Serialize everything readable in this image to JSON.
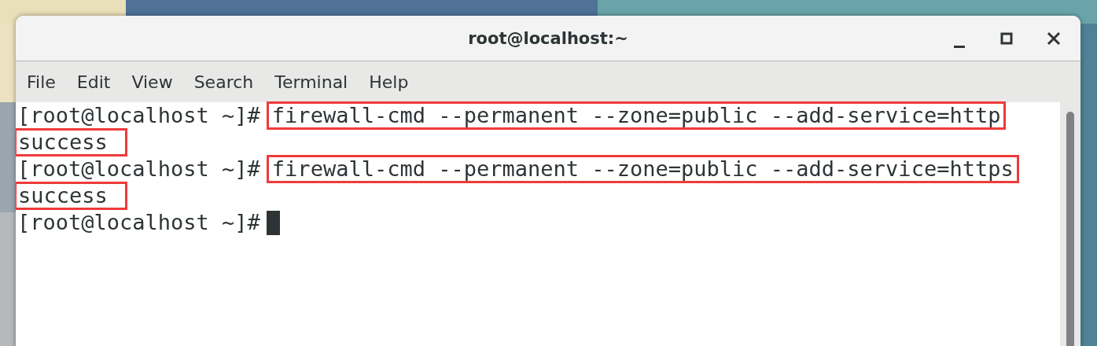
{
  "window": {
    "title": "root@localhost:~"
  },
  "menu": [
    "File",
    "Edit",
    "View",
    "Search",
    "Terminal",
    "Help"
  ],
  "terminal": {
    "lines": [
      {
        "kind": "prompt",
        "prompt": "[root@localhost ~]#",
        "command": "firewall-cmd --permanent --zone=public --add-service=http",
        "highlighted": true
      },
      {
        "kind": "output",
        "text": "success",
        "highlighted": true
      },
      {
        "kind": "prompt",
        "prompt": "[root@localhost ~]#",
        "command": "firewall-cmd --permanent --zone=public --add-service=https",
        "highlighted": true
      },
      {
        "kind": "output",
        "text": "success",
        "highlighted": true
      },
      {
        "kind": "prompt",
        "prompt": "[root@localhost ~]#",
        "cursor": true
      }
    ]
  }
}
